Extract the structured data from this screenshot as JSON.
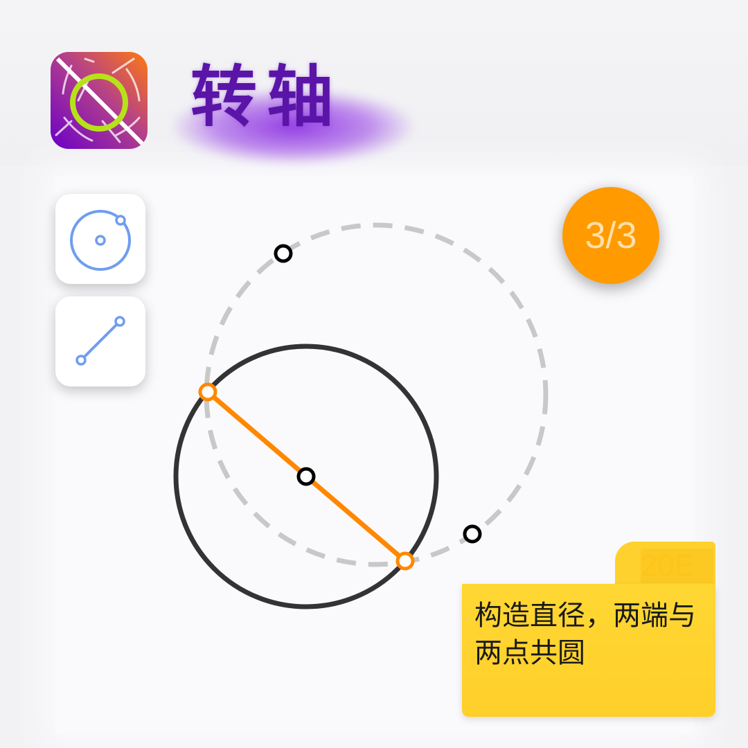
{
  "app": {
    "title": "转轴",
    "icon": "rotation-axis-app-icon"
  },
  "tools": [
    {
      "name": "circle-tool",
      "icon": "circle-with-center-icon"
    },
    {
      "name": "line-tool",
      "icon": "line-segment-icon"
    }
  ],
  "level": {
    "progress": "3/3"
  },
  "hint": {
    "code": "20E",
    "text": "构造直径，两端与两点共圆"
  },
  "colors": {
    "accent_orange": "#ff8800",
    "badge_orange": "#ff9a00",
    "title_purple": "#5a14a8",
    "note_yellow": "#ffd733",
    "tool_blue": "#6f9df0",
    "dashed_gray": "#c8c8c8",
    "circle_dark": "#333333"
  }
}
